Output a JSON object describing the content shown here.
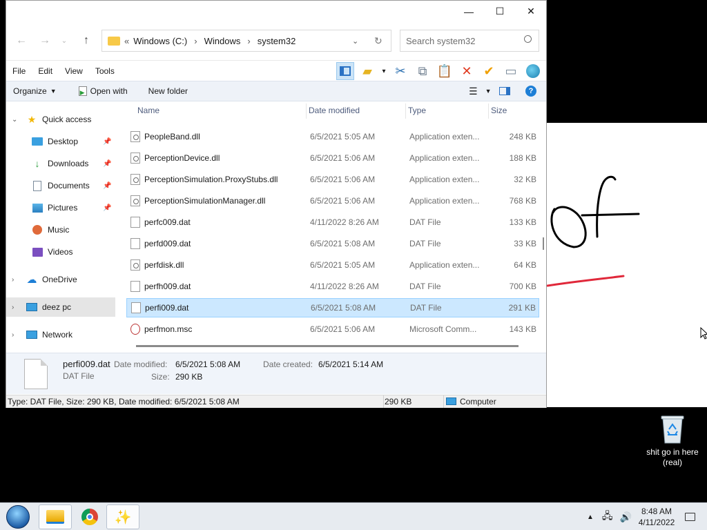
{
  "window": {
    "controls": {
      "minimize": "—",
      "maximize": "☐",
      "close": "✕"
    }
  },
  "address": {
    "prefix": "«",
    "crumbs": [
      "Windows (C:)",
      "Windows",
      "system32"
    ],
    "separator": "›"
  },
  "search": {
    "placeholder": "Search system32"
  },
  "menu": {
    "items": [
      "File",
      "Edit",
      "View",
      "Tools"
    ]
  },
  "commands": {
    "organize": "Organize",
    "open_with": "Open with",
    "new_folder": "New folder"
  },
  "nav": {
    "quick_access": "Quick access",
    "desktop": "Desktop",
    "downloads": "Downloads",
    "documents": "Documents",
    "pictures": "Pictures",
    "music": "Music",
    "videos": "Videos",
    "onedrive": "OneDrive",
    "this_pc": "deez pc",
    "network": "Network"
  },
  "columns": {
    "name": "Name",
    "date": "Date modified",
    "type": "Type",
    "size": "Size"
  },
  "files": [
    {
      "name": "PeopleBand.dll",
      "date": "6/5/2021 5:05 AM",
      "type": "Application exten...",
      "size": "248 KB",
      "icon": "dll"
    },
    {
      "name": "PerceptionDevice.dll",
      "date": "6/5/2021 5:06 AM",
      "type": "Application exten...",
      "size": "188 KB",
      "icon": "dll"
    },
    {
      "name": "PerceptionSimulation.ProxyStubs.dll",
      "date": "6/5/2021 5:06 AM",
      "type": "Application exten...",
      "size": "32 KB",
      "icon": "dll"
    },
    {
      "name": "PerceptionSimulationManager.dll",
      "date": "6/5/2021 5:06 AM",
      "type": "Application exten...",
      "size": "768 KB",
      "icon": "dll"
    },
    {
      "name": "perfc009.dat",
      "date": "4/11/2022 8:26 AM",
      "type": "DAT File",
      "size": "133 KB",
      "icon": "dat"
    },
    {
      "name": "perfd009.dat",
      "date": "6/5/2021 5:08 AM",
      "type": "DAT File",
      "size": "33 KB",
      "icon": "dat"
    },
    {
      "name": "perfdisk.dll",
      "date": "6/5/2021 5:05 AM",
      "type": "Application exten...",
      "size": "64 KB",
      "icon": "dll"
    },
    {
      "name": "perfh009.dat",
      "date": "4/11/2022 8:26 AM",
      "type": "DAT File",
      "size": "700 KB",
      "icon": "dat"
    },
    {
      "name": "perfi009.dat",
      "date": "6/5/2021 5:08 AM",
      "type": "DAT File",
      "size": "291 KB",
      "icon": "dat"
    },
    {
      "name": "perfmon.msc",
      "date": "6/5/2021 5:06 AM",
      "type": "Microsoft Comm...",
      "size": "143 KB",
      "icon": "msc"
    }
  ],
  "selected_index": 8,
  "details": {
    "name": "perfi009.dat",
    "type": "DAT File",
    "modified_label": "Date modified:",
    "modified_value": "6/5/2021 5:08 AM",
    "created_label": "Date created:",
    "created_value": "6/5/2021 5:14 AM",
    "size_label": "Size:",
    "size_value": "290 KB"
  },
  "status": {
    "text": "Type: DAT File, Size: 290 KB, Date modified: 6/5/2021 5:08 AM",
    "size": "290 KB",
    "location": "Computer"
  },
  "desktop": {
    "recycle_bin": "shit go in here (real)"
  },
  "taskbar": {
    "time": "8:48 AM",
    "date": "4/11/2022"
  },
  "colors": {
    "selection": "#cce8ff",
    "accent": "#0078d7",
    "paint_red": "#e0283a"
  }
}
